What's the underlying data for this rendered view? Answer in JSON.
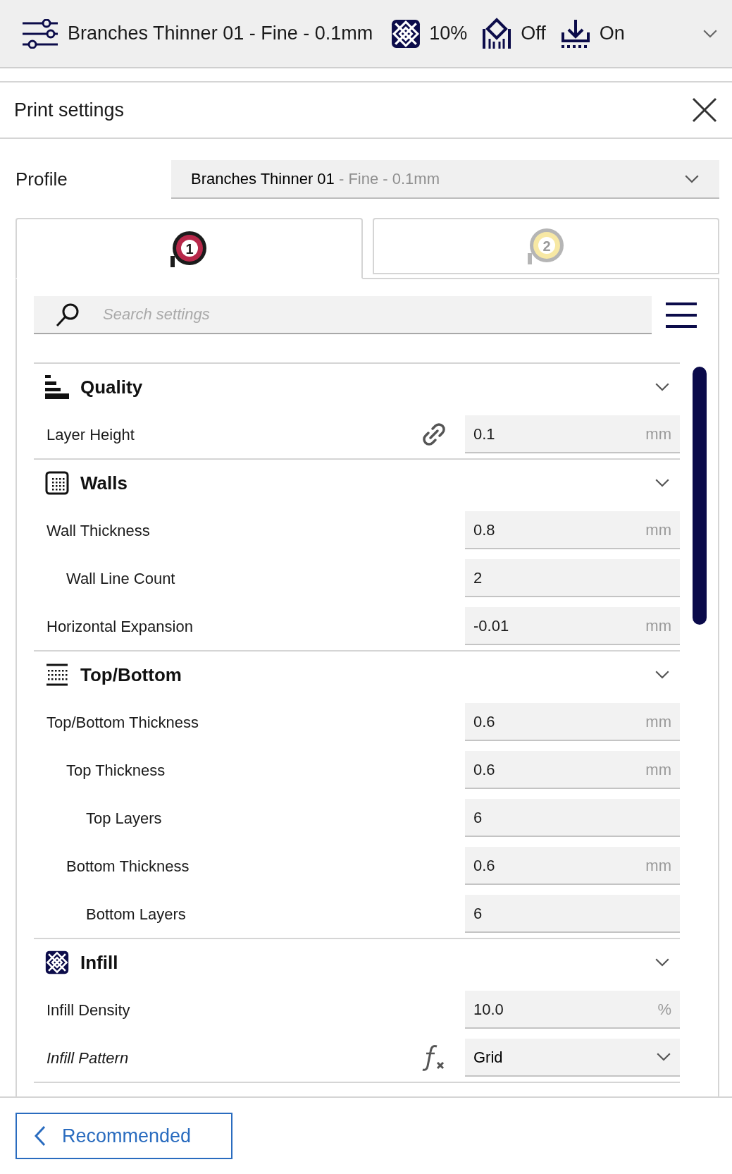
{
  "top_bar": {
    "profile": "Branches Thinner 01 - Fine - 0.1mm",
    "infill": "10%",
    "support": "Off",
    "adhesion": "On"
  },
  "panel": {
    "title": "Print settings"
  },
  "profile": {
    "label": "Profile",
    "name": "Branches Thinner 01",
    "suffix": " - Fine - 0.1mm"
  },
  "extruder_tabs": [
    {
      "label": "1",
      "selected": true,
      "color": "#b7284a"
    },
    {
      "label": "2",
      "selected": false,
      "color": "#f7e8a4"
    }
  ],
  "search": {
    "placeholder": "Search settings"
  },
  "sections": [
    {
      "title": "Quality",
      "settings": [
        {
          "label": "Layer Height",
          "kind": "number",
          "value": "0.1",
          "unit": "mm",
          "linked": true,
          "formula": false,
          "italic": false
        }
      ]
    },
    {
      "title": "Walls",
      "settings": [
        {
          "label": "Wall Thickness",
          "kind": "number",
          "value": "0.8",
          "unit": "mm",
          "linked": false,
          "formula": false,
          "italic": false,
          "children": [
            {
              "label": "Wall Line Count",
              "kind": "number",
              "value": "2",
              "linked": false,
              "formula": false,
              "italic": false
            }
          ]
        },
        {
          "label": "Horizontal Expansion",
          "kind": "number",
          "value": "-0.01",
          "unit": "mm",
          "linked": false,
          "formula": false,
          "italic": false
        }
      ]
    },
    {
      "title": "Top/Bottom",
      "settings": [
        {
          "label": "Top/Bottom Thickness",
          "kind": "number",
          "value": "0.6",
          "unit": "mm",
          "linked": false,
          "formula": false,
          "italic": false,
          "children": [
            {
              "label": "Top Thickness",
              "kind": "number",
              "value": "0.6",
              "unit": "mm",
              "linked": false,
              "formula": false,
              "italic": false,
              "children": [
                {
                  "label": "Top Layers",
                  "kind": "number",
                  "value": "6",
                  "linked": false,
                  "formula": false,
                  "italic": false
                }
              ]
            },
            {
              "label": "Bottom Thickness",
              "kind": "number",
              "value": "0.6",
              "unit": "mm",
              "linked": false,
              "formula": false,
              "italic": false,
              "children": [
                {
                  "label": "Bottom Layers",
                  "kind": "number",
                  "value": "6",
                  "linked": false,
                  "formula": false,
                  "italic": false
                }
              ]
            }
          ]
        }
      ]
    },
    {
      "title": "Infill",
      "settings": [
        {
          "label": "Infill Density",
          "kind": "number",
          "value": "10.0",
          "unit": "%",
          "linked": false,
          "formula": false,
          "italic": false
        },
        {
          "label": "Infill Pattern",
          "kind": "dropdown",
          "value": "Grid",
          "linked": false,
          "formula": true,
          "italic": true
        }
      ]
    }
  ],
  "footer": {
    "button": "Recommended"
  }
}
